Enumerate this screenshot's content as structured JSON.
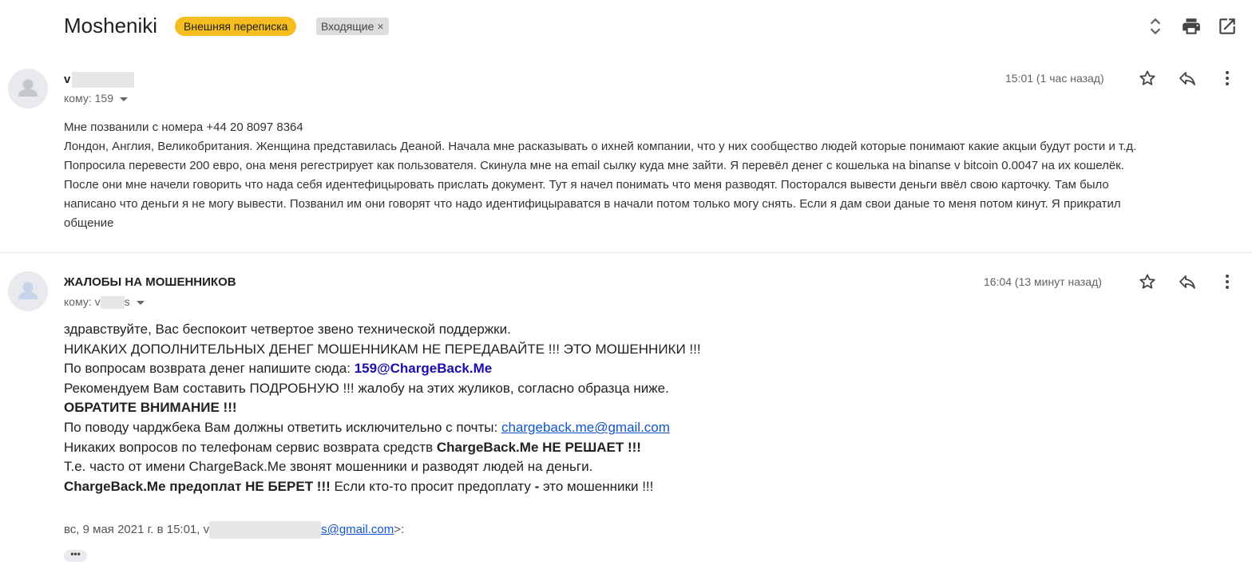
{
  "header": {
    "subject": "Mosheniki",
    "labels": [
      {
        "text": "Внешняя переписка",
        "color": "#f5bd1f"
      },
      {
        "text": "Входящие",
        "remove": "×"
      }
    ],
    "icons": [
      "expand-collapse-icon",
      "print-icon",
      "open-new-window-icon"
    ]
  },
  "messages": [
    {
      "sender": "v",
      "to_label": "кому:",
      "to": "159",
      "time": "15:01 (1 час назад)",
      "icons": [
        "star-icon",
        "reply-icon",
        "more-vert-icon"
      ],
      "body": [
        "Мне позванили с номера +44 20 8097 8364",
        "Лондон, Англия, Великобритания. Женщина представилась Деаной. Начала мне расказывать о ихней компании, что у них сообщество людей которые понимают какие акцыи будут рости и т.д.",
        "Попросила перевести 200 евро, она меня регестрирует как пользователя. Скинула мне на email сылку куда мне зайти. Я перевёл денег с кошелька на binanse v bitcoin 0.0047 на их кошелёк.",
        "После они мне начели говорить что нада себя идентефицыровать прислать документ. Тут я начел понимать что меня разводят. Посторался вывести деньги ввёл свою карточку. Там было",
        "написано что деньги я не могу вывести. Позванил им они говорят что надо идентифицыраватся в начали потом только могу снять. Если я дам свои даные то меня потом кинут. Я прикратил",
        "общение"
      ]
    },
    {
      "sender": "ЖАЛОБЫ НА МОШЕННИКОВ",
      "to_label": "кому:",
      "to_prefix": "v",
      "to_suffix": "s",
      "time": "16:04 (13 минут назад)",
      "icons": [
        "star-icon",
        "reply-icon",
        "more-vert-icon"
      ],
      "lines": {
        "l1": "здравствуйте, Вас беспокоит четвертое звено технической поддержки.",
        "l2": "НИКАКИХ ДОПОЛНИТЕЛЬНЫХ ДЕНЕГ МОШЕННИКАМ НЕ ПЕРЕДАВАЙТЕ !!! ЭТО МОШЕННИКИ !!!",
        "l3_text": "По вопросам возврата денег напишите сюда: ",
        "l3_email": "159@ChargeBack.Me",
        "l4": "Рекомендуем Вам составить ПОДРОБНУЮ !!! жалобу на этих жуликов, согласно образца ниже.",
        "l5": "ОБРАТИТЕ ВНИМАНИЕ !!!",
        "l6_text": "По поводу чарджбека Вам должны ответить исключительно с почты: ",
        "l6_email": "chargeback.me@gmail.com",
        "l7_text": "Никаких вопросов по телефонам сервис возврата средств ",
        "l7_bold": "ChargeBack.Me НЕ РЕШАЕТ !!!",
        "l8": "Т.е. часто от имени ChargeBack.Me звонят мошенники и разводят людей на деньги.",
        "l9_bold": "ChargeBack.Me предоплат НЕ БЕРЕТ !!!",
        "l9_text": " Если кто-то просит предоплату ",
        "l9_dash": "-",
        "l9_end": " это мошенники !!!"
      },
      "quote": {
        "date_text": "вс, 9 мая 2021 г. в 15:01, v",
        "email_tail": "s@gmail.com",
        "end": ">:"
      },
      "ellipsis": "•••"
    }
  ]
}
